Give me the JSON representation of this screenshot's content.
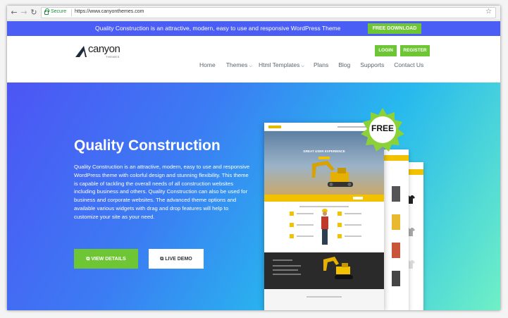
{
  "browser": {
    "secure_label": "Secure",
    "url": "https://www.canyonthemes.com"
  },
  "topbar": {
    "text": "Quality Construction is an attractive, modern, easy to use and responsive WordPress Theme",
    "free_download": "FREE DOWNLOAD"
  },
  "header": {
    "logo_text": "canyon",
    "logo_sub": "THEMES",
    "login": "LOGIN",
    "register": "REGISTER",
    "menu": [
      {
        "label": "Home"
      },
      {
        "label": "Themes"
      },
      {
        "label": "Html Templates"
      },
      {
        "label": "Plans"
      },
      {
        "label": "Blog"
      },
      {
        "label": "Supports"
      },
      {
        "label": "Contact Us"
      }
    ]
  },
  "hero": {
    "title": "Quality Construction",
    "description": "Quality Construction is an attractive, modern, easy to use and responsive WordPress theme with colorful design and stunning flexibility. This theme is capable of tackling the overall needs of all construction websites including business and others. Quality Construction can also be used for business and corporate websites. The advanced theme options and available various widgets with drag and drop features will help to customize your site as your need.",
    "view_details": "VIEW DETAILS",
    "live_demo": "LIVE DEMO",
    "badge": "FREE",
    "preview_heading": "GREAT USER EXPERIENCE"
  },
  "colors": {
    "accent_green": "#6ec635",
    "topbar_blue": "#4a5ef6",
    "construction_yellow": "#f2c200"
  },
  "icons": {
    "back": "arrow-left-icon",
    "forward": "arrow-right-icon",
    "reload": "reload-icon",
    "secure": "lock-icon",
    "bookmark": "star-icon",
    "external": "external-link-icon"
  }
}
